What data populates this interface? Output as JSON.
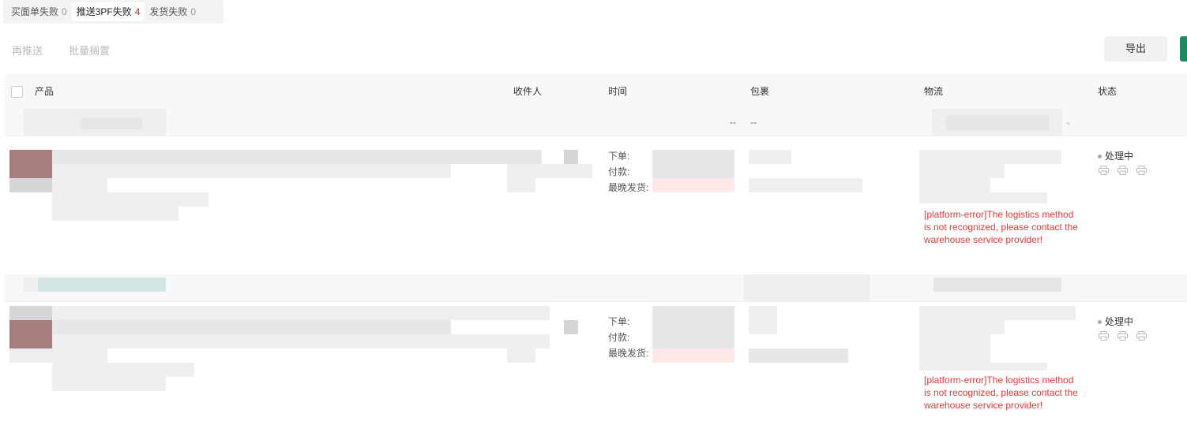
{
  "tabs": [
    {
      "label": "买面单失败",
      "count": "0"
    },
    {
      "label": "推送3PF失败",
      "count": "4"
    },
    {
      "label": "发货失败",
      "count": "0"
    }
  ],
  "toolbar": {
    "repush": "再推送",
    "batch_hold": "批量搁置",
    "export": "导出"
  },
  "columns": {
    "product": "产品",
    "recipient": "收件人",
    "time": "时间",
    "package": "包裹",
    "logistics": "物流",
    "status": "状态"
  },
  "orders": [
    {
      "group_dashes": "--",
      "group_dashes2": "--",
      "time_labels": {
        "order": "下单:",
        "paid": "付款:",
        "latest_ship": "最晚发货:"
      },
      "error": "[platform-error]The logistics method is not recognized, please contact the warehouse service provider!",
      "status": "处理中"
    },
    {
      "time_labels": {
        "order": "下单:",
        "paid": "付款:",
        "latest_ship": "最晚发货:"
      },
      "error": "[platform-error]The logistics method is not recognized, please contact the warehouse service provider!",
      "status": "处理中"
    }
  ]
}
